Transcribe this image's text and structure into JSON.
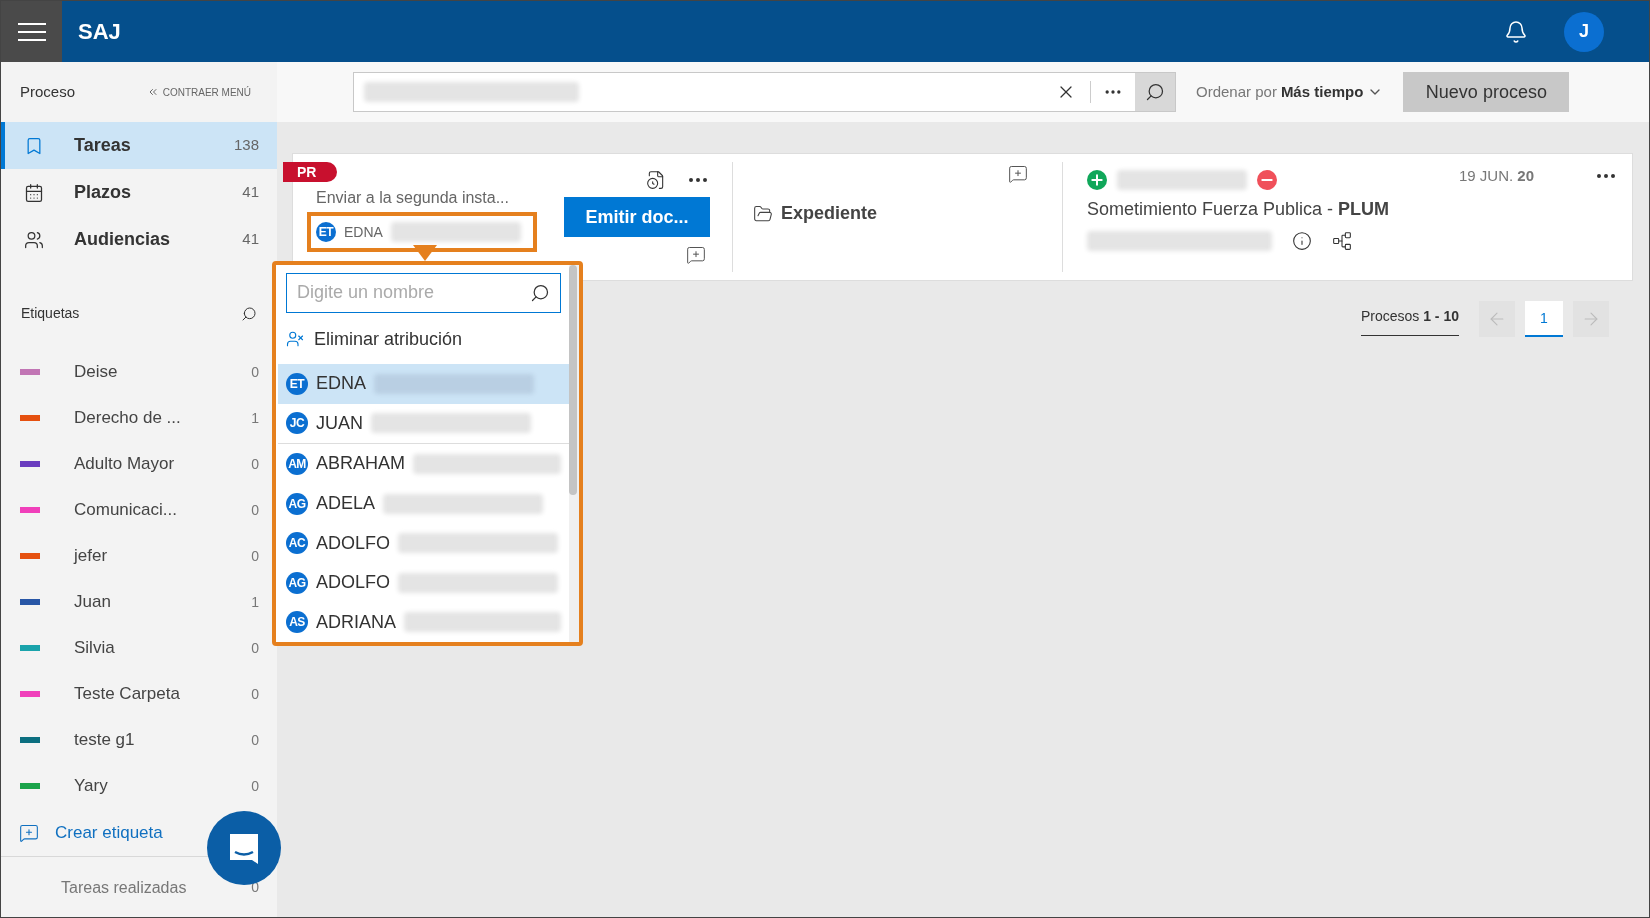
{
  "app": {
    "title": "SAJ",
    "user_initial": "J"
  },
  "sidebar": {
    "header": "Proceso",
    "collapse": "CONTRAER MENÚ",
    "nav": [
      {
        "kind": "bookmark",
        "label": "Tareas",
        "count": "138",
        "selected": true
      },
      {
        "kind": "calendar",
        "label": "Plazos",
        "count": "41",
        "selected": false
      },
      {
        "kind": "people",
        "label": "Audiencias",
        "count": "41",
        "selected": false
      }
    ],
    "tags_header": "Etiquetas",
    "tags": [
      {
        "label": "Deise",
        "count": "0",
        "color": "#c175b4"
      },
      {
        "label": "Derecho de ...",
        "count": "1",
        "color": "#e5500f"
      },
      {
        "label": "Adulto Mayor",
        "count": "0",
        "color": "#6a3cbf"
      },
      {
        "label": "Comunicaci...",
        "count": "0",
        "color": "#f03fba"
      },
      {
        "label": "jefer",
        "count": "0",
        "color": "#e5500f"
      },
      {
        "label": "Juan",
        "count": "1",
        "color": "#2856a6"
      },
      {
        "label": "Silvia",
        "count": "0",
        "color": "#1aa3ab"
      },
      {
        "label": "Teste Carpeta",
        "count": "0",
        "color": "#f03fba"
      },
      {
        "label": "teste g1",
        "count": "0",
        "color": "#0b6e7f"
      },
      {
        "label": "Yary",
        "count": "0",
        "color": "#1aa34a"
      }
    ],
    "create_tag": "Crear etiqueta",
    "done": {
      "label": "Tareas realizadas",
      "count": "0"
    }
  },
  "toolbar": {
    "sort_label": "Ordenar por",
    "sort_value": "Más tiempo",
    "new_button": "Nuevo proceso"
  },
  "card": {
    "badge": "PR",
    "task": "Enviar a la segunda insta...",
    "assignee": {
      "initials": "ET",
      "name": "EDNA"
    },
    "action": "Emitir doc...",
    "folder": "Expediente",
    "subject": "Sometimiento Fuerza Publica - **PLUM**",
    "date": "19 JUN. **20**"
  },
  "assign_menu": {
    "placeholder": "Digite un nombre",
    "remove": "Eliminar atribución",
    "recent": [
      {
        "initials": "ET",
        "name": "EDNA",
        "selected": true
      },
      {
        "initials": "JC",
        "name": "JUAN",
        "selected": false
      }
    ],
    "people": [
      {
        "initials": "AM",
        "name": "ABRAHAM",
        "selected": false
      },
      {
        "initials": "AG",
        "name": "ADELA",
        "selected": false
      },
      {
        "initials": "AC",
        "name": "ADOLFO",
        "selected": false
      },
      {
        "initials": "AG",
        "name": "ADOLFO",
        "selected": false
      },
      {
        "initials": "AS",
        "name": "ADRIANA",
        "selected": false
      }
    ]
  },
  "pagination": {
    "label": "Procesos **1 - 10**",
    "pages": [
      {
        "label": "1",
        "selected": true
      }
    ]
  }
}
